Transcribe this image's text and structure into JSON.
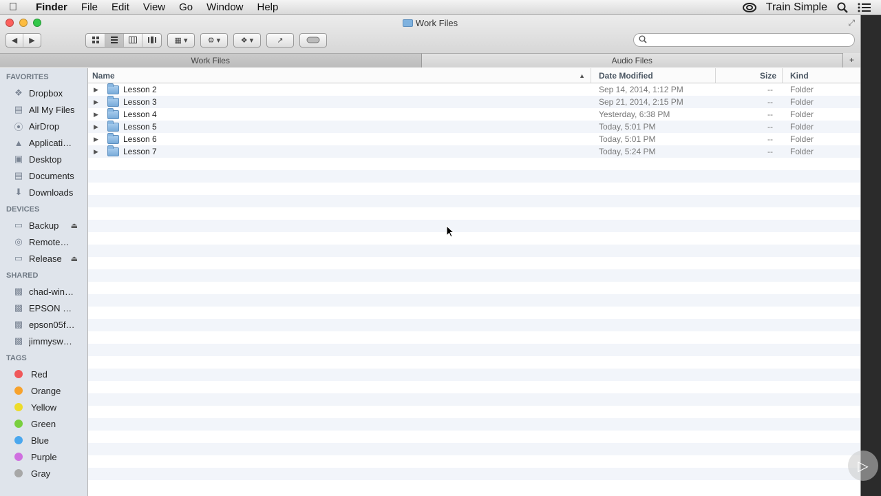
{
  "menubar": {
    "app": "Finder",
    "items": [
      "File",
      "Edit",
      "View",
      "Go",
      "Window",
      "Help"
    ],
    "user": "Train Simple",
    "icons": [
      "apple-icon",
      "creative-cloud-icon",
      "spotlight-icon",
      "notification-list-icon"
    ]
  },
  "window": {
    "title": "Work Files",
    "search_placeholder": "",
    "tabs": [
      {
        "label": "Work Files",
        "active": true
      },
      {
        "label": "Audio Files",
        "active": false
      }
    ],
    "tab_add": "+"
  },
  "sidebar": {
    "favorites_header": "FAVORITES",
    "favorites": [
      {
        "label": "Dropbox",
        "icon": "dropbox-icon"
      },
      {
        "label": "All My Files",
        "icon": "all-files-icon"
      },
      {
        "label": "AirDrop",
        "icon": "airdrop-icon"
      },
      {
        "label": "Applicati…",
        "icon": "applications-icon"
      },
      {
        "label": "Desktop",
        "icon": "desktop-icon"
      },
      {
        "label": "Documents",
        "icon": "documents-icon"
      },
      {
        "label": "Downloads",
        "icon": "downloads-icon"
      }
    ],
    "devices_header": "DEVICES",
    "devices": [
      {
        "label": "Backup",
        "icon": "disk-icon",
        "eject": true
      },
      {
        "label": "Remote…",
        "icon": "remote-disc-icon",
        "eject": false
      },
      {
        "label": "Release",
        "icon": "disk-icon",
        "eject": true
      }
    ],
    "shared_header": "SHARED",
    "shared": [
      {
        "label": "chad-win…",
        "icon": "computer-icon"
      },
      {
        "label": "EPSON W…",
        "icon": "computer-icon"
      },
      {
        "label": "epson05f…",
        "icon": "computer-icon"
      },
      {
        "label": "jimmysw…",
        "icon": "computer-icon"
      }
    ],
    "tags_header": "TAGS",
    "tags": [
      {
        "label": "Red",
        "color": "#f0585a"
      },
      {
        "label": "Orange",
        "color": "#f7a22c"
      },
      {
        "label": "Yellow",
        "color": "#eddc2a"
      },
      {
        "label": "Green",
        "color": "#79cf3e"
      },
      {
        "label": "Blue",
        "color": "#4aa7ee"
      },
      {
        "label": "Purple",
        "color": "#cf6fe0"
      },
      {
        "label": "Gray",
        "color": "#a7a7a7"
      }
    ]
  },
  "list": {
    "columns": {
      "name": "Name",
      "date": "Date Modified",
      "size": "Size",
      "kind": "Kind"
    },
    "rows": [
      {
        "name": "Lesson 2",
        "date": "Sep 14, 2014, 1:12 PM",
        "size": "--",
        "kind": "Folder"
      },
      {
        "name": "Lesson 3",
        "date": "Sep 21, 2014, 2:15 PM",
        "size": "--",
        "kind": "Folder"
      },
      {
        "name": "Lesson 4",
        "date": "Yesterday, 6:38 PM",
        "size": "--",
        "kind": "Folder"
      },
      {
        "name": "Lesson 5",
        "date": "Today, 5:01 PM",
        "size": "--",
        "kind": "Folder"
      },
      {
        "name": "Lesson 6",
        "date": "Today, 5:01 PM",
        "size": "--",
        "kind": "Folder"
      },
      {
        "name": "Lesson 7",
        "date": "Today, 5:24 PM",
        "size": "--",
        "kind": "Folder"
      }
    ],
    "empty_rows": 27
  }
}
